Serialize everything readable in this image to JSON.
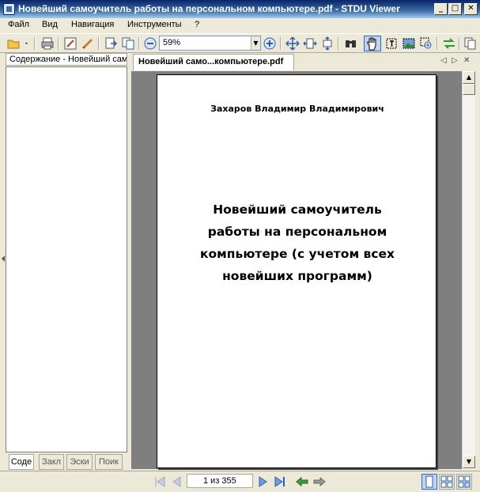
{
  "window": {
    "title": "Новейший самоучитель работы на персональном компьютере.pdf - STDU Viewer",
    "minimize": "_",
    "maximize": "□",
    "close": "✕"
  },
  "menu": [
    "Файл",
    "Вид",
    "Навигация",
    "Инструменты",
    "?"
  ],
  "toolbar": {
    "zoom_value": "59%",
    "icons": [
      "open-folder-icon",
      "print-icon",
      "edit-icon",
      "pen-icon",
      "page-export-icon",
      "page-copy-icon",
      "zoom-out-icon",
      "zoom-in-icon",
      "fit-page-icon",
      "fit-width-icon",
      "fit-height-icon",
      "find-icon",
      "hand-tool-icon",
      "text-select-icon",
      "image-select-icon",
      "zoom-tool-icon",
      "sync-icon",
      "copy-icon"
    ]
  },
  "left_panel": {
    "header": "Содержание - Новейший сам",
    "tabs": [
      "Соде",
      "Закл",
      "Эски",
      "Поик"
    ]
  },
  "doc_tab": {
    "label": "Новейший само...компьютере.pdf",
    "nav_prev": "◁",
    "nav_next": "▷",
    "close": "✕"
  },
  "page_content": {
    "author": "Захаров Владимир Владимирович",
    "title": "Новейший самоучитель работы на персональном компьютере (с учетом всех новейших программ)"
  },
  "scrollbar": {
    "up": "▲",
    "down": "▼"
  },
  "navigation": {
    "page_indicator": "1 из 355"
  }
}
